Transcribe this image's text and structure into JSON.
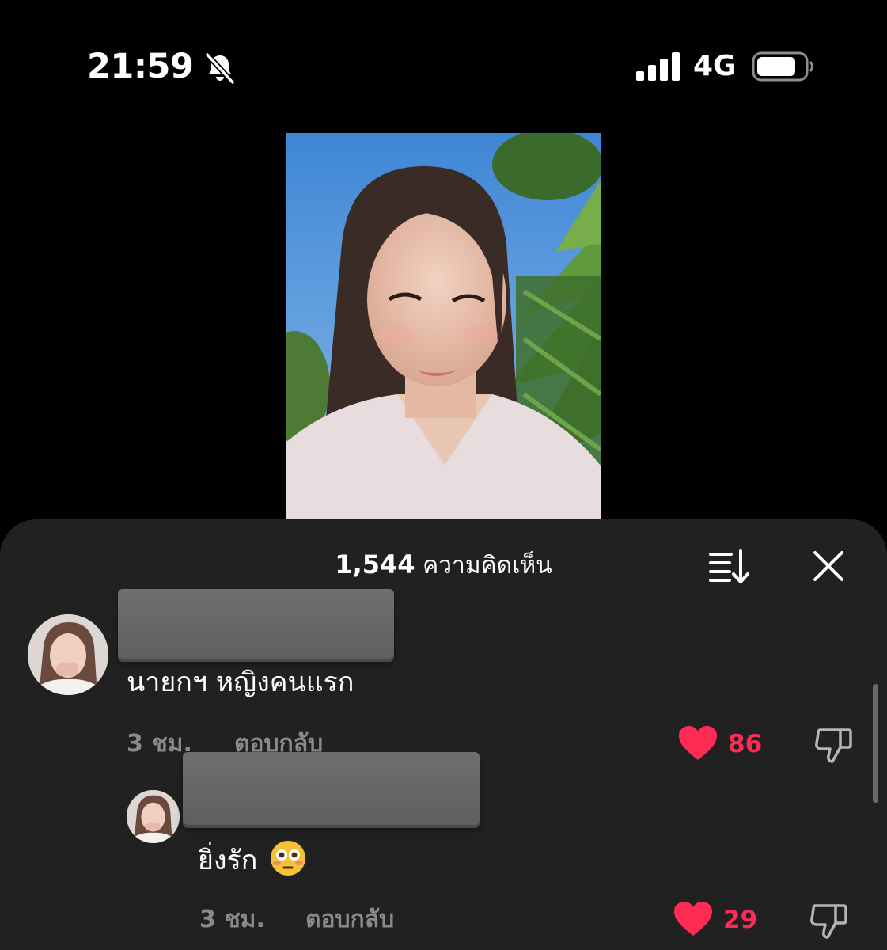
{
  "status_bar": {
    "time": "21:59",
    "network": "4G",
    "icons": [
      "bell-slash-icon",
      "cellular-signal-icon",
      "battery-icon"
    ]
  },
  "video": {
    "content": "portrait-photo"
  },
  "comments_sheet": {
    "count": "1,544",
    "count_label": "ความคิดเห็น",
    "icons": [
      "sort-icon",
      "close-icon"
    ],
    "comments": [
      {
        "text": "นายกฯ หญิงคนแรก",
        "time": "3 ชม.",
        "reply_label": "ตอบกลับ",
        "likes": "86"
      },
      {
        "text": "ยิ่งรัก",
        "emoji": "flushed-face-emoji",
        "time": "3 ชม.",
        "reply_label": "ตอบกลับ",
        "likes": "29"
      }
    ]
  },
  "colors": {
    "background": "#000000",
    "sheet": "#212121",
    "like_accent": "#fe2c55",
    "muted_text": "#8a8a8a"
  }
}
